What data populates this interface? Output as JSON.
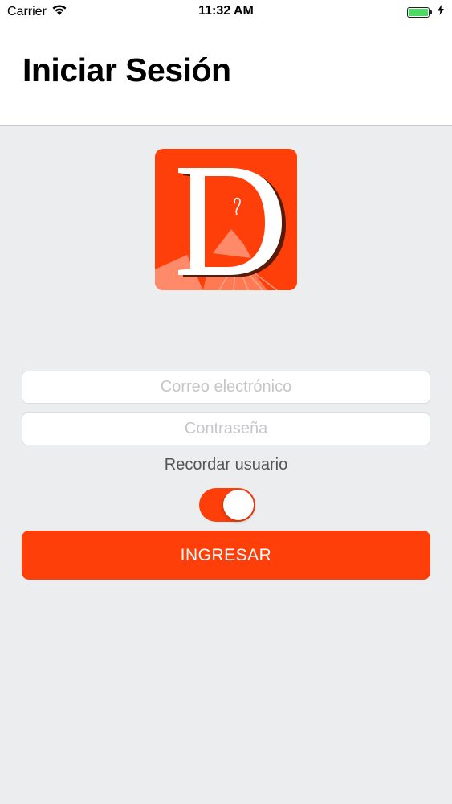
{
  "status_bar": {
    "carrier": "Carrier",
    "time": "11:32 AM",
    "battery_level": 1.0
  },
  "header": {
    "title": "Iniciar Sesión"
  },
  "logo": {
    "letter": "D",
    "background_color": "#ff3f0a"
  },
  "form": {
    "email": {
      "placeholder": "Correo electrónico",
      "value": ""
    },
    "password": {
      "placeholder": "Contraseña",
      "value": ""
    },
    "remember_label": "Recordar usuario",
    "remember_on": true,
    "submit_label": "INGRESAR"
  },
  "colors": {
    "accent": "#ff3f0a",
    "background": "#ebedef"
  }
}
